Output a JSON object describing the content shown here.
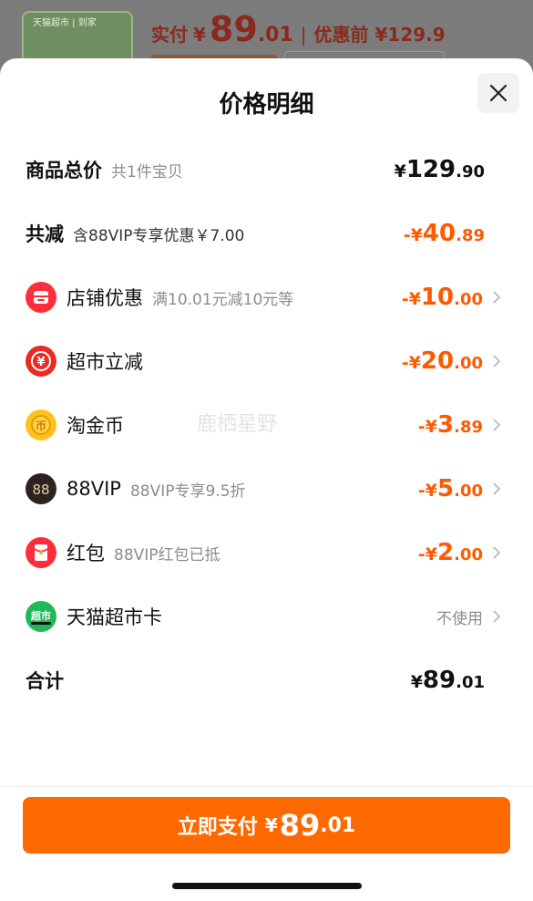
{
  "background": {
    "thumb_text": "天猫超市 | 到家",
    "price_label": "实付",
    "price_currency": "¥",
    "price_int": "89",
    "price_dec": ".01",
    "price_before": "优惠前 ¥129.9"
  },
  "sheet": {
    "title": "价格明细",
    "close_icon": "close-icon"
  },
  "rows": {
    "total": {
      "label": "商品总价",
      "sub": "共1件宝贝",
      "pre": "¥",
      "int": "129",
      "dec": ".90"
    },
    "reduce": {
      "label": "共减",
      "sub": "含88VIP专享优惠￥7.00",
      "pre": "-¥",
      "int": "40",
      "dec": ".89"
    },
    "store": {
      "label": "店铺优惠",
      "sub": "满10.01元减10元等",
      "pre": "-¥",
      "int": "10",
      "dec": ".00",
      "icon": "store-icon"
    },
    "market": {
      "label": "超市立减",
      "pre": "-¥",
      "int": "20",
      "dec": ".00",
      "icon": "yen-discount-icon"
    },
    "coin": {
      "label": "淘金币",
      "pre": "-¥",
      "int": "3",
      "dec": ".89",
      "icon": "coin-icon"
    },
    "vip": {
      "label": "88VIP",
      "sub": "88VIP专享9.5折",
      "pre": "-¥",
      "int": "5",
      "dec": ".00",
      "icon": "vip88-icon"
    },
    "redpacket": {
      "label": "红包",
      "sub": "88VIP红包已抵",
      "pre": "-¥",
      "int": "2",
      "dec": ".00",
      "icon": "red-packet-icon"
    },
    "card": {
      "label": "天猫超市卡",
      "right": "不使用",
      "icon": "tmall-market-icon"
    },
    "sum": {
      "label": "合计",
      "pre": "¥",
      "int": "89",
      "dec": ".01"
    }
  },
  "watermark": "鹿栖星野",
  "pay_button": {
    "label": "立即支付",
    "pre": "¥",
    "int": "89",
    "dec": ".01"
  },
  "colors": {
    "accent": "#ff6a00",
    "discount": "#ff5a00"
  },
  "icons": {
    "vip88_text": "88",
    "market_badge_text": "超市",
    "coin_text": "币",
    "yen_text": "¥"
  }
}
